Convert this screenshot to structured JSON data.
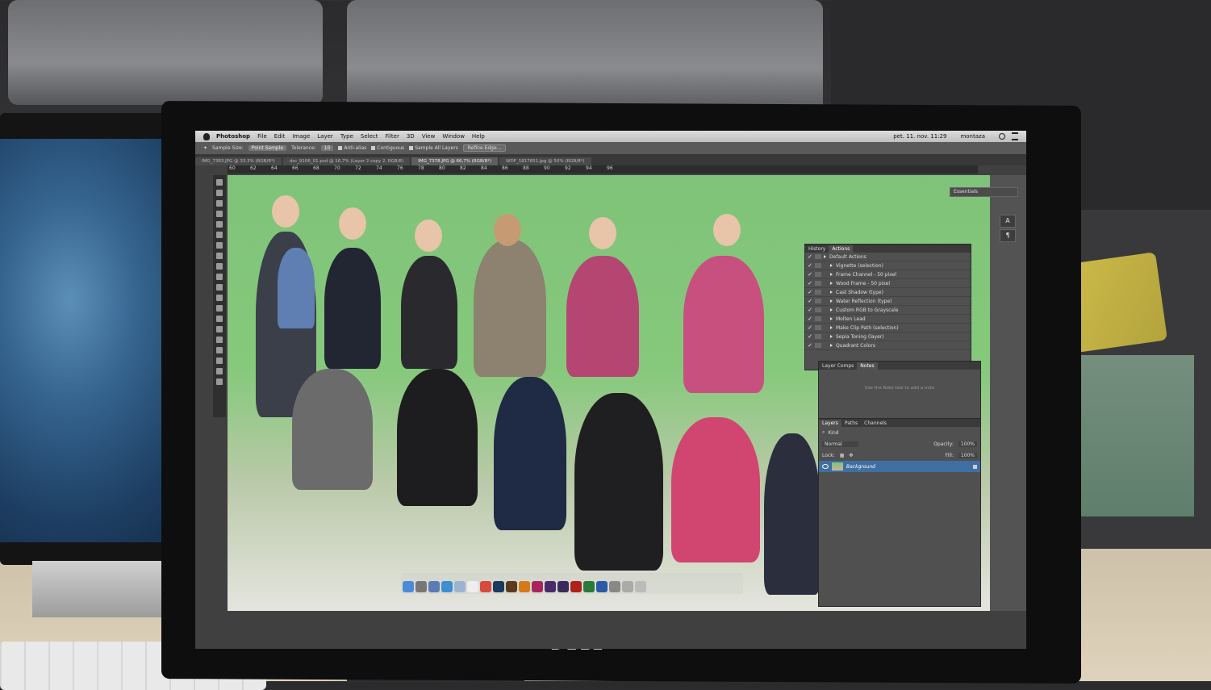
{
  "menu": {
    "app_name": "Photoshop",
    "items": [
      "File",
      "Edit",
      "Image",
      "Layer",
      "Type",
      "Select",
      "Filter",
      "3D",
      "View",
      "Window",
      "Help"
    ],
    "clock": "pet. 11. nov.  11:29",
    "user": "montaza"
  },
  "options": {
    "sample_size_label": "Sample Size:",
    "sample_size_value": "Point Sample",
    "tolerance_label": "Tolerance:",
    "tolerance_value": "10",
    "anti_alias": "Anti-alias",
    "contiguous": "Contiguous",
    "sample_all_layers": "Sample All Layers",
    "refine_edge": "Refine Edge..."
  },
  "tabs": [
    {
      "label": "IMG_7383.JPG @ 33,3% (RGB/8*)"
    },
    {
      "label": "dsc_9106_01.psd @ 16,7% (Layer 2 copy 2, RGB/8)"
    },
    {
      "label": "IMG_7378.JPG @ 66,7% (RGB/8*)"
    },
    {
      "label": "WDF_1817851.jpg @ 50% (RGB/8*)"
    }
  ],
  "ruler": [
    "60",
    "62",
    "64",
    "66",
    "68",
    "70",
    "72",
    "74",
    "76",
    "78",
    "80",
    "82",
    "84",
    "86",
    "88",
    "90",
    "92",
    "94",
    "96"
  ],
  "workspace": "Essentials",
  "actions_panel": {
    "tabs": [
      "History",
      "Actions"
    ],
    "set": "Default Actions",
    "items": [
      "Vignette (selection)",
      "Frame Channel - 50 pixel",
      "Wood Frame - 50 pixel",
      "Cast Shadow (type)",
      "Water Reflection (type)",
      "Custom RGB to Grayscale",
      "Molten Lead",
      "Make Clip Path (selection)",
      "Sepia Toning (layer)",
      "Quadrant Colors"
    ]
  },
  "notes_panel": {
    "tabs": [
      "Layer Comps",
      "Notes"
    ],
    "hint": "Use the Note tool to add a note"
  },
  "layers_panel": {
    "tabs": [
      "Layers",
      "Paths",
      "Channels"
    ],
    "kind": "Kind",
    "blend_mode": "Normal",
    "opacity_label": "Opacity:",
    "opacity_value": "100%",
    "lock_label": "Lock:",
    "fill_label": "Fill:",
    "fill_value": "100%",
    "layer_name": "Background"
  },
  "monitor_brand": "DELL"
}
